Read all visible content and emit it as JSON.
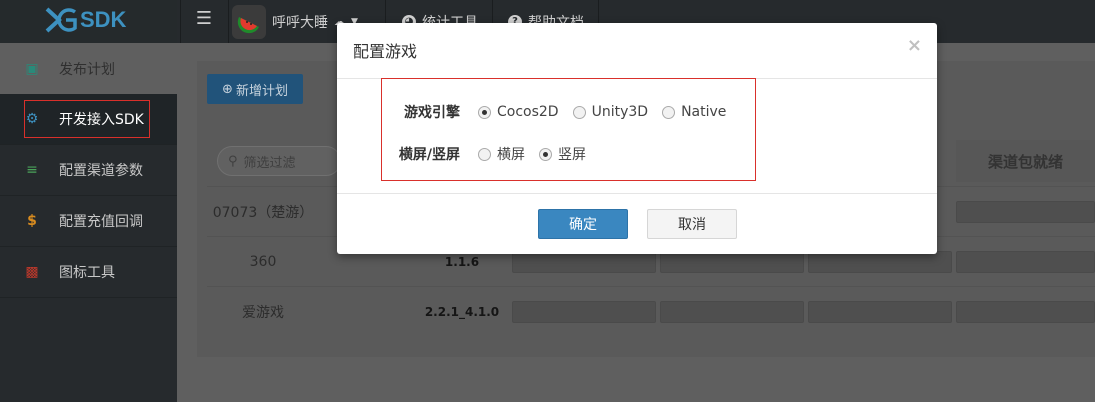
{
  "navbar": {
    "logo_text": "SDK",
    "menu_icon": "hamburger-icon",
    "app_name": "呼呼大睡",
    "stats_label": "统计工具",
    "help_label": "帮助文档"
  },
  "sidebar": {
    "items": [
      {
        "label": "发布计划",
        "icon": "calendar-icon"
      },
      {
        "label": "开发接入SDK",
        "icon": "gear-icon"
      },
      {
        "label": "配置渠道参数",
        "icon": "list-icon"
      },
      {
        "label": "配置充值回调",
        "icon": "dollar-icon"
      },
      {
        "label": "图标工具",
        "icon": "image-icon"
      }
    ]
  },
  "main": {
    "add_button": "新增计划",
    "search_placeholder": "筛选过滤",
    "col_header": "渠道包就绪",
    "rows": [
      {
        "name": "07073（楚游）",
        "version": ""
      },
      {
        "name": "360",
        "version": "1.1.6"
      },
      {
        "name": "爱游戏",
        "version": "2.2.1_4.1.0"
      }
    ]
  },
  "modal": {
    "title": "配置游戏",
    "close": "×",
    "engine_label": "游戏引擎",
    "engine_options": [
      "Cocos2D",
      "Unity3D",
      "Native"
    ],
    "engine_selected": "Cocos2D",
    "orientation_label": "横屏/竖屏",
    "orientation_options": [
      "横屏",
      "竖屏"
    ],
    "orientation_selected": "竖屏",
    "ok_label": "确定",
    "cancel_label": "取消"
  },
  "colors": {
    "primary": "#3a87c0",
    "highlight_border": "#d9302b",
    "sidebar_bg": "#262a2d"
  }
}
